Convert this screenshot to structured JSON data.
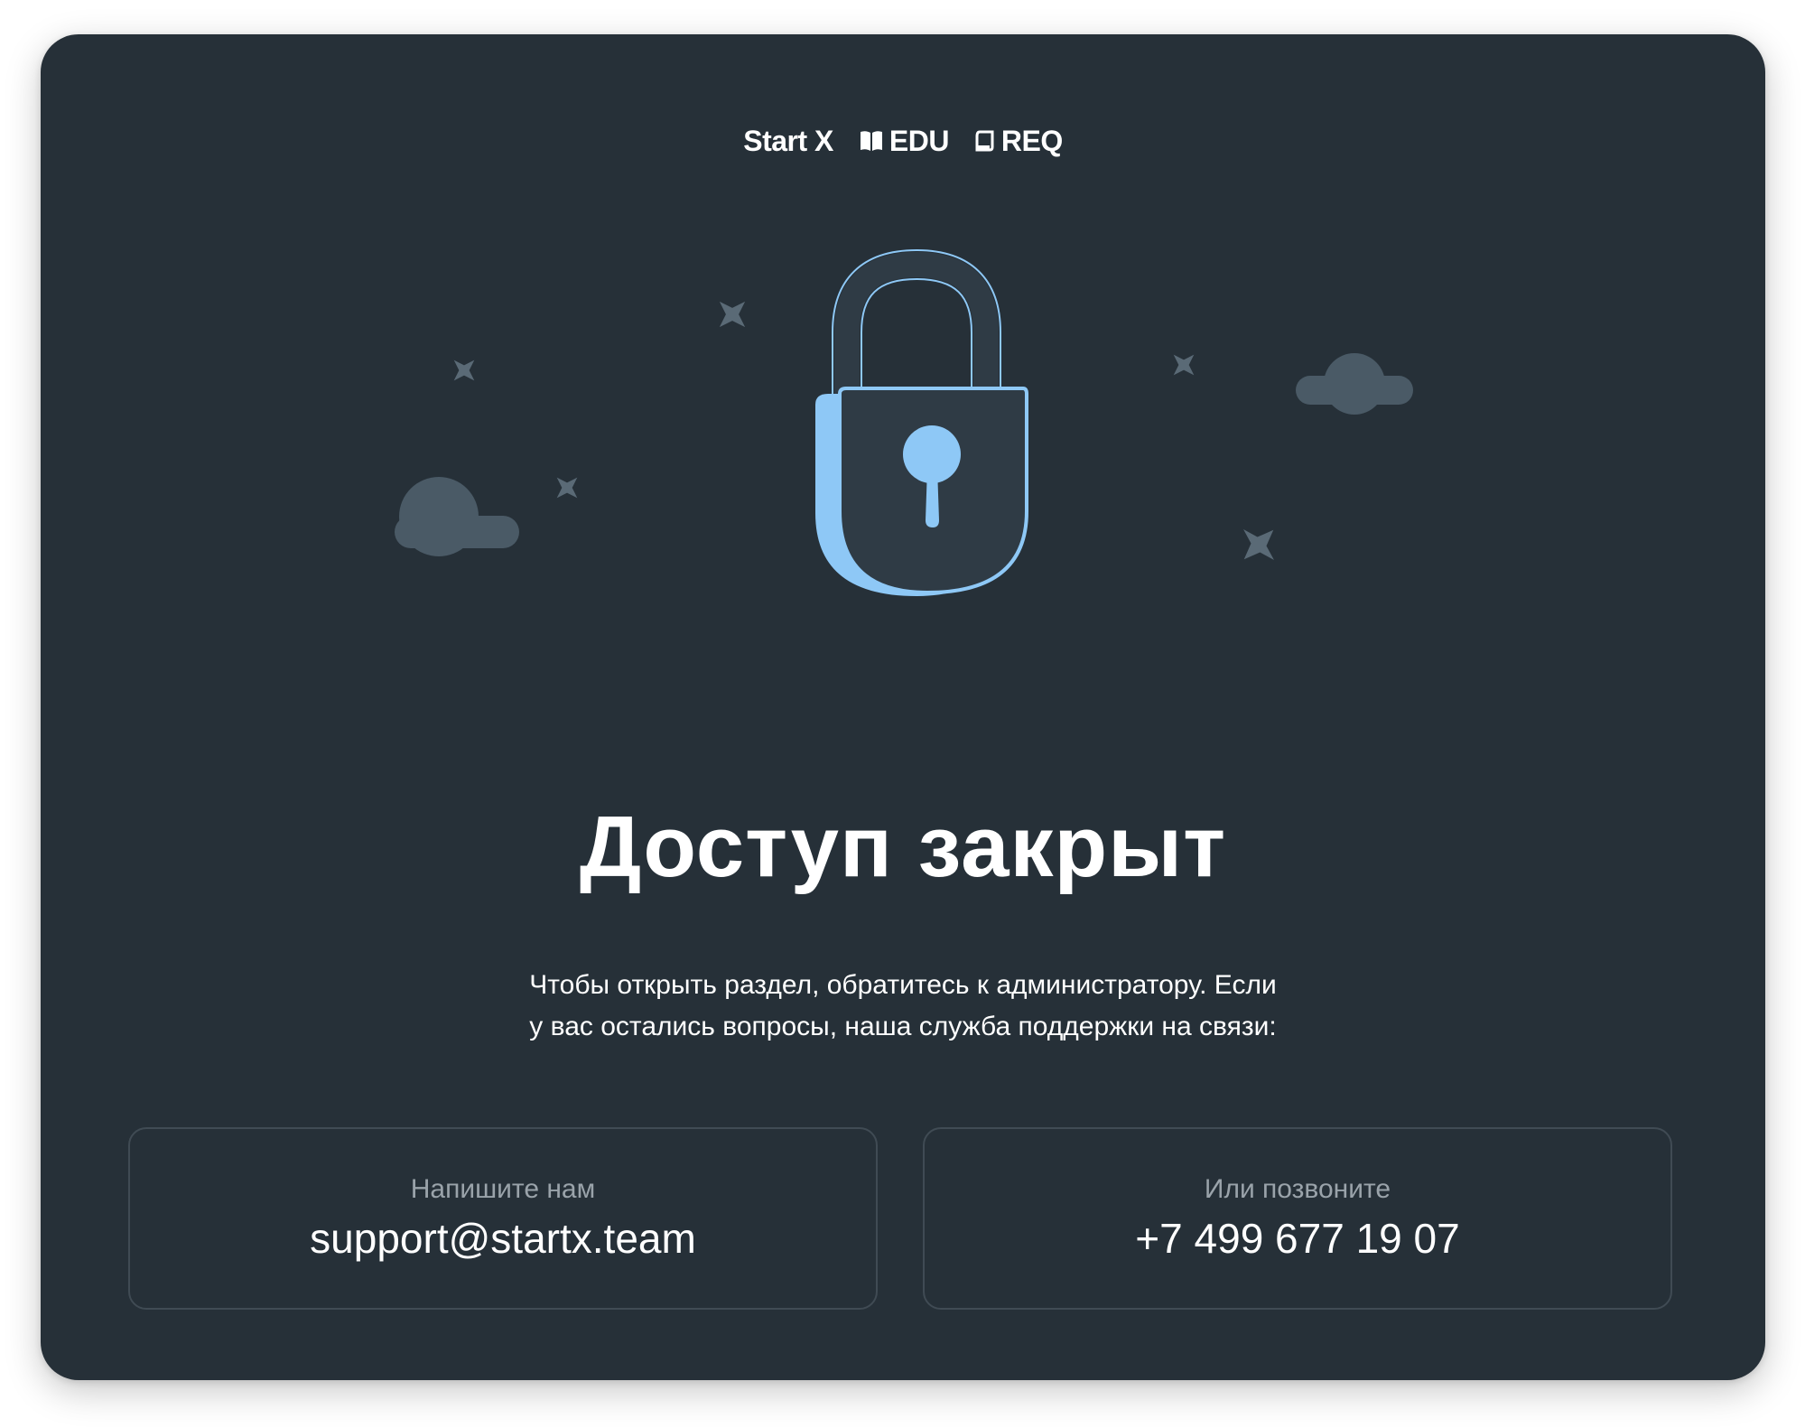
{
  "brands": [
    {
      "label": "Start X",
      "icon": "startx-logo"
    },
    {
      "label": "EDU",
      "icon": "book-icon"
    },
    {
      "label": "REQ",
      "icon": "document-icon"
    }
  ],
  "illustration": {
    "icon": "padlock-icon",
    "decorations": [
      "cloud-icon",
      "cloud-icon",
      "sparkle-icon",
      "sparkle-icon",
      "sparkle-icon",
      "sparkle-icon",
      "sparkle-icon"
    ]
  },
  "main": {
    "title": "Доступ закрыт",
    "description_line1": "Чтобы открыть раздел, обратитесь к администратору. Если",
    "description_line2": "у вас остались вопросы, наша служба поддержки на связи:"
  },
  "contacts": {
    "email": {
      "label": "Напишите нам",
      "value": "support@startx.team"
    },
    "phone": {
      "label": "Или позвоните",
      "value": "+7 499 677 19 07"
    }
  },
  "colors": {
    "background": "#263038",
    "accent": "#8ec8f6",
    "lock_body": "#2f3b45",
    "cloud": "#4a5a66",
    "sparkle": "#5a6a76",
    "card_border": "#404b54",
    "label_text": "#9aa3aa",
    "text": "#ffffff"
  }
}
